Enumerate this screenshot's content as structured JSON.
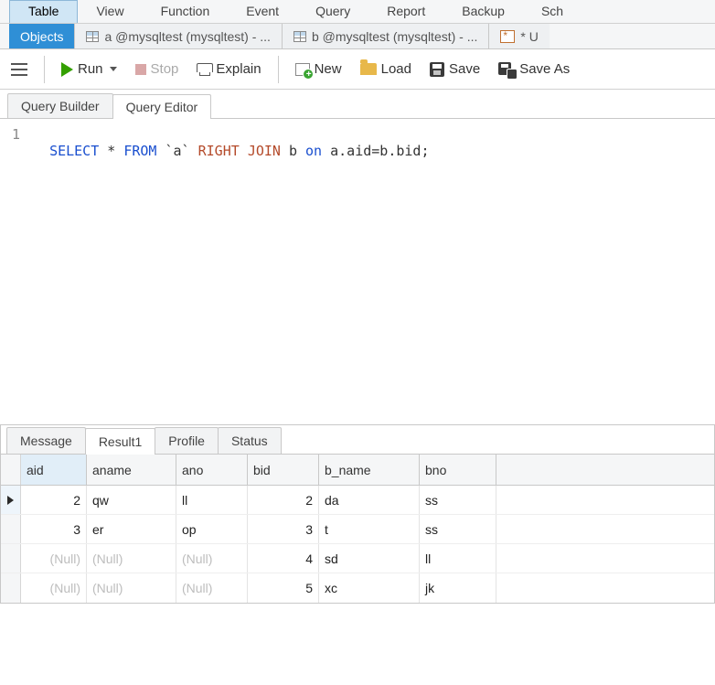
{
  "main_menu": {
    "items": [
      "Table",
      "View",
      "Function",
      "Event",
      "Query",
      "Report",
      "Backup",
      "Sch"
    ],
    "active_index": 0
  },
  "object_tabs": {
    "objects_label": "Objects",
    "tabs": [
      {
        "label": "a @mysqltest (mysqltest) - ..."
      },
      {
        "label": "b @mysqltest (mysqltest) - ..."
      }
    ],
    "overflow_label": "* U"
  },
  "toolbar": {
    "run_label": "Run",
    "stop_label": "Stop",
    "explain_label": "Explain",
    "new_label": "New",
    "load_label": "Load",
    "save_label": "Save",
    "save_as_label": "Save As"
  },
  "query_tabs": {
    "builder_label": "Query Builder",
    "editor_label": "Query Editor",
    "active": "editor"
  },
  "editor": {
    "line_number": "1",
    "tokens": {
      "select": "SELECT",
      "star": "*",
      "from": "FROM",
      "tbl_a": "`a`",
      "right": "RIGHT",
      "join": "JOIN",
      "tbl_b": "b",
      "on": "on",
      "cond": "a.aid=b.bid;"
    }
  },
  "result_tabs": {
    "tabs": [
      "Message",
      "Result1",
      "Profile",
      "Status"
    ],
    "active_index": 1
  },
  "grid": {
    "columns": [
      "aid",
      "aname",
      "ano",
      "bid",
      "b_name",
      "bno"
    ],
    "null_text": "(Null)",
    "active_col_index": 0,
    "rows": [
      {
        "active": true,
        "aid": "2",
        "aname": "qw",
        "ano": "ll",
        "bid": "2",
        "b_name": "da",
        "bno": "ss"
      },
      {
        "active": false,
        "aid": "3",
        "aname": "er",
        "ano": "op",
        "bid": "3",
        "b_name": "t",
        "bno": "ss"
      },
      {
        "active": false,
        "aid": null,
        "aname": null,
        "ano": null,
        "bid": "4",
        "b_name": "sd",
        "bno": "ll"
      },
      {
        "active": false,
        "aid": null,
        "aname": null,
        "ano": null,
        "bid": "5",
        "b_name": "xc",
        "bno": "jk"
      }
    ]
  }
}
